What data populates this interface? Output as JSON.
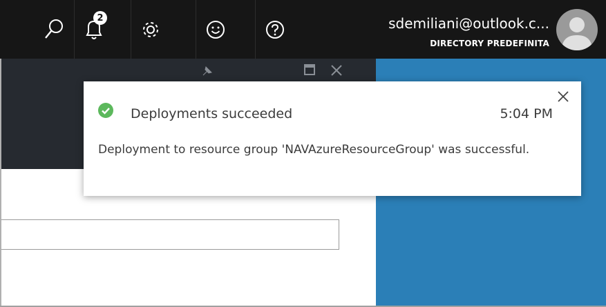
{
  "topbar": {
    "icons": [
      "search-icon",
      "bell-icon",
      "gear-icon",
      "smiley-icon",
      "help-icon"
    ],
    "notification_count": "2",
    "account": {
      "email": "sdemiliani@outlook.c...",
      "directory": "DIRECTORY PREDEFINITA"
    }
  },
  "toast": {
    "status_icon": "check-circle-icon",
    "title": "Deployments succeeded",
    "time": "5:04 PM",
    "message": "Deployment to resource group 'NAVAzureResourceGroup' was successful.",
    "close_icon": "close-icon"
  },
  "colors": {
    "topbar_bg": "#161616",
    "blade_header_bg": "#262a30",
    "right_panel_bg": "#2b7fb7",
    "success_green": "#5cb85c"
  }
}
